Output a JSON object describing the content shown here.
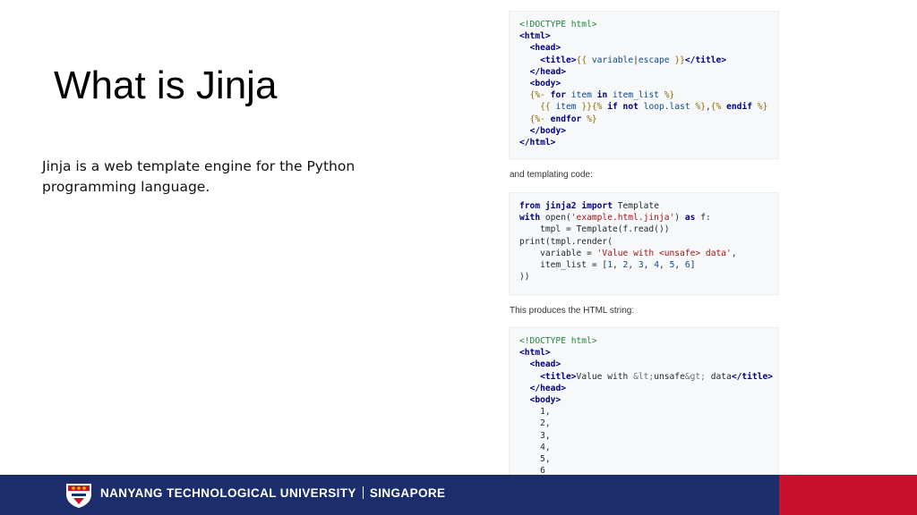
{
  "slide": {
    "title": "What is Jinja",
    "description_line1": "Jinja is a web template engine for the Python",
    "description_line2": "programming language."
  },
  "captions": {
    "templating_code": "and templating code:",
    "produces": "This produces the HTML string:"
  },
  "footer": {
    "university": "NANYANG TECHNOLOGICAL UNIVERSITY",
    "location": "SINGAPORE",
    "colors": {
      "bar": "#1b2e6b",
      "accent": "#c8102e"
    }
  }
}
